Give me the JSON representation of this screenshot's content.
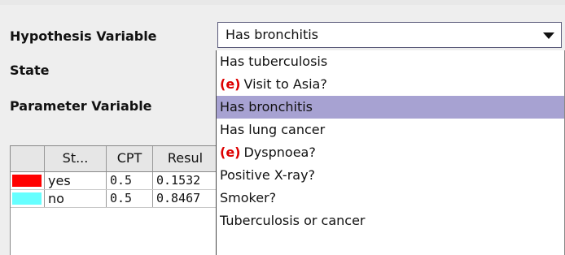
{
  "form": {
    "hypothesis_label": "Hypothesis Variable",
    "state_label": "State",
    "parameter_label": "Parameter Variable"
  },
  "hypothesis_combo": {
    "selected": "Has bronchitis",
    "arrow_icon": "triangle-down-icon",
    "options": [
      {
        "label": "Has tuberculosis",
        "evidence": false,
        "selected": false
      },
      {
        "label": "Visit to Asia?",
        "evidence": true,
        "selected": false
      },
      {
        "label": "Has bronchitis",
        "evidence": false,
        "selected": true
      },
      {
        "label": "Has lung cancer",
        "evidence": false,
        "selected": false
      },
      {
        "label": "Dyspnoea?",
        "evidence": true,
        "selected": false
      },
      {
        "label": "Positive X-ray?",
        "evidence": false,
        "selected": false
      },
      {
        "label": "Smoker?",
        "evidence": false,
        "selected": false
      },
      {
        "label": "Tuberculosis or cancer",
        "evidence": false,
        "selected": false
      }
    ],
    "evidence_marker": "(e)",
    "selected_color": "#a7a2d2",
    "evidence_color": "#dd0000"
  },
  "table": {
    "headers": [
      "",
      "St...",
      "CPT",
      "Resul"
    ],
    "rows": [
      {
        "color": "#ff0000",
        "state": "yes",
        "cpt": "0.5",
        "result": "0.1532"
      },
      {
        "color": "#66ffff",
        "state": "no",
        "cpt": "0.5",
        "result": "0.8467"
      }
    ]
  }
}
